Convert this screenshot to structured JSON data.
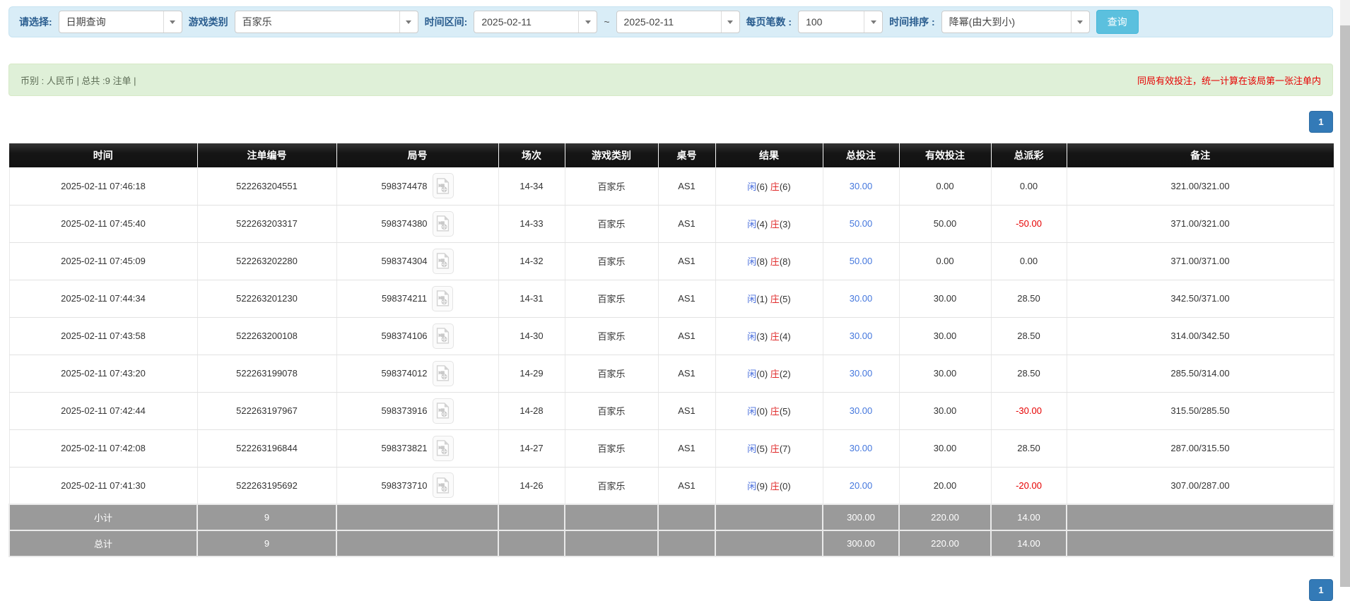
{
  "colors": {
    "filter_bg": "#d9edf7",
    "info_bg": "#dff0d8",
    "accent_button": "#5bc0de",
    "pagination_blue": "#337ab7",
    "header_black": "#151515",
    "summary_gray": "#9a9a9a",
    "link_blue": "#4477dd",
    "player_blue": "#4a6fdd",
    "banker_red": "#e02b2b",
    "negative_red": "#e60000"
  },
  "filter_bar": {
    "select_label": "请选择:",
    "select_value": "日期查询",
    "game_type_label": "游戏类别",
    "game_type_value": "百家乐",
    "time_range_label": "时间区间:",
    "time_from": "2025-02-11",
    "range_separator": "~",
    "time_to": "2025-02-11",
    "page_size_label": "每页笔数 :",
    "page_size_value": "100",
    "sort_label": "时间排序 :",
    "sort_value": "降幂(由大到小)",
    "search_button": "查询"
  },
  "info_bar": {
    "summary": "币别 : 人民币 | 总共 :9 注单 |",
    "notice": "同局有效投注，统一计算在该局第一张注单内"
  },
  "pagination": {
    "page": "1"
  },
  "table": {
    "headers": [
      "时间",
      "注单编号",
      "局号",
      "场次",
      "游戏类别",
      "桌号",
      "结果",
      "总投注",
      "有效投注",
      "总派彩",
      "备注"
    ],
    "rows": [
      {
        "time": "2025-02-11 07:46:18",
        "bet_id": "522263204551",
        "round_id": "598374478",
        "session": "14-34",
        "game": "百家乐",
        "table_no": "AS1",
        "player": "闲",
        "player_score": "(6)",
        "banker": "庄",
        "banker_score": "(6)",
        "total_bet": "30.00",
        "valid_bet": "0.00",
        "payout": "0.00",
        "note": "321.00/321.00"
      },
      {
        "time": "2025-02-11 07:45:40",
        "bet_id": "522263203317",
        "round_id": "598374380",
        "session": "14-33",
        "game": "百家乐",
        "table_no": "AS1",
        "player": "闲",
        "player_score": "(4)",
        "banker": "庄",
        "banker_score": "(3)",
        "total_bet": "50.00",
        "valid_bet": "50.00",
        "payout": "-50.00",
        "note": "371.00/321.00"
      },
      {
        "time": "2025-02-11 07:45:09",
        "bet_id": "522263202280",
        "round_id": "598374304",
        "session": "14-32",
        "game": "百家乐",
        "table_no": "AS1",
        "player": "闲",
        "player_score": "(8)",
        "banker": "庄",
        "banker_score": "(8)",
        "total_bet": "50.00",
        "valid_bet": "0.00",
        "payout": "0.00",
        "note": "371.00/371.00"
      },
      {
        "time": "2025-02-11 07:44:34",
        "bet_id": "522263201230",
        "round_id": "598374211",
        "session": "14-31",
        "game": "百家乐",
        "table_no": "AS1",
        "player": "闲",
        "player_score": "(1)",
        "banker": "庄",
        "banker_score": "(5)",
        "total_bet": "30.00",
        "valid_bet": "30.00",
        "payout": "28.50",
        "note": "342.50/371.00"
      },
      {
        "time": "2025-02-11 07:43:58",
        "bet_id": "522263200108",
        "round_id": "598374106",
        "session": "14-30",
        "game": "百家乐",
        "table_no": "AS1",
        "player": "闲",
        "player_score": "(3)",
        "banker": "庄",
        "banker_score": "(4)",
        "total_bet": "30.00",
        "valid_bet": "30.00",
        "payout": "28.50",
        "note": "314.00/342.50"
      },
      {
        "time": "2025-02-11 07:43:20",
        "bet_id": "522263199078",
        "round_id": "598374012",
        "session": "14-29",
        "game": "百家乐",
        "table_no": "AS1",
        "player": "闲",
        "player_score": "(0)",
        "banker": "庄",
        "banker_score": "(2)",
        "total_bet": "30.00",
        "valid_bet": "30.00",
        "payout": "28.50",
        "note": "285.50/314.00"
      },
      {
        "time": "2025-02-11 07:42:44",
        "bet_id": "522263197967",
        "round_id": "598373916",
        "session": "14-28",
        "game": "百家乐",
        "table_no": "AS1",
        "player": "闲",
        "player_score": "(0)",
        "banker": "庄",
        "banker_score": "(5)",
        "total_bet": "30.00",
        "valid_bet": "30.00",
        "payout": "-30.00",
        "note": "315.50/285.50"
      },
      {
        "time": "2025-02-11 07:42:08",
        "bet_id": "522263196844",
        "round_id": "598373821",
        "session": "14-27",
        "game": "百家乐",
        "table_no": "AS1",
        "player": "闲",
        "player_score": "(5)",
        "banker": "庄",
        "banker_score": "(7)",
        "total_bet": "30.00",
        "valid_bet": "30.00",
        "payout": "28.50",
        "note": "287.00/315.50"
      },
      {
        "time": "2025-02-11 07:41:30",
        "bet_id": "522263195692",
        "round_id": "598373710",
        "session": "14-26",
        "game": "百家乐",
        "table_no": "AS1",
        "player": "闲",
        "player_score": "(9)",
        "banker": "庄",
        "banker_score": "(0)",
        "total_bet": "20.00",
        "valid_bet": "20.00",
        "payout": "-20.00",
        "note": "307.00/287.00"
      }
    ],
    "subtotal": {
      "label": "小计",
      "count": "9",
      "total_bet": "300.00",
      "valid_bet": "220.00",
      "payout": "14.00"
    },
    "total": {
      "label": "总计",
      "count": "9",
      "total_bet": "300.00",
      "valid_bet": "220.00",
      "payout": "14.00"
    }
  }
}
